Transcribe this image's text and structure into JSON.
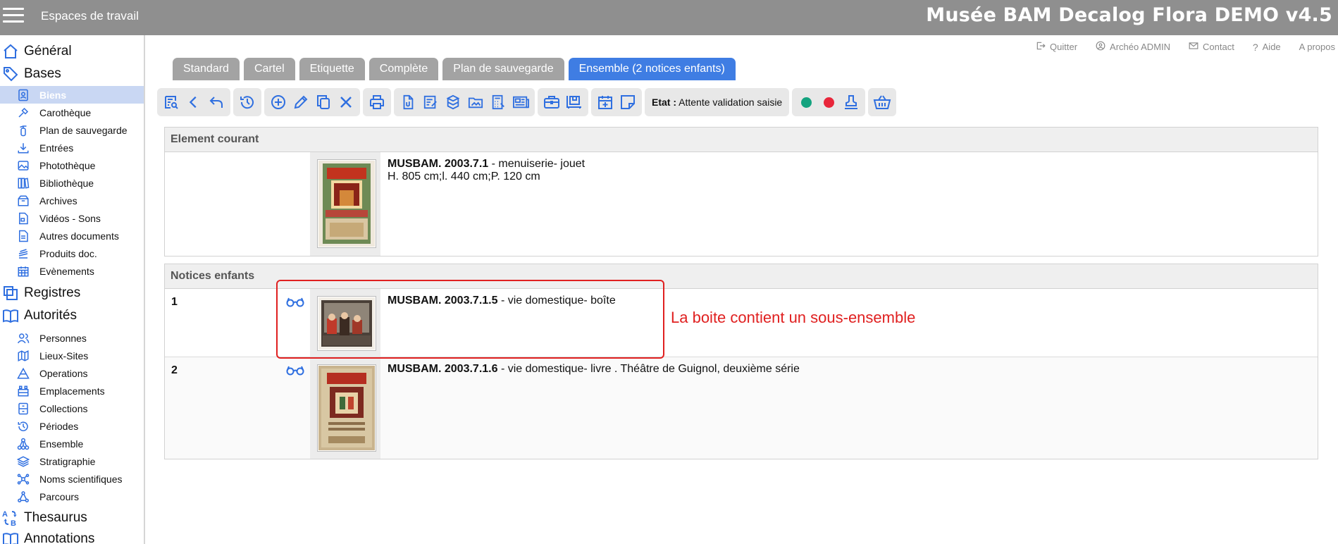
{
  "topbar": {
    "workspaces": "Espaces de travail",
    "app_title": "Musée BAM Decalog Flora DEMO v4.5"
  },
  "sidebar": {
    "sections": [
      {
        "label": "Général",
        "icon": "home-icon"
      },
      {
        "label": "Bases",
        "icon": "tag-icon"
      },
      {
        "label": "Registres",
        "icon": "copy-icon"
      },
      {
        "label": "Autorités",
        "icon": "book-icon"
      },
      {
        "label": "Thesaurus",
        "icon": "sort-az-icon"
      },
      {
        "label": "Annotations",
        "icon": "book-icon"
      }
    ],
    "bases_items": [
      {
        "label": "Biens",
        "icon": "user-badge-icon",
        "active": true
      },
      {
        "label": "Carothèque",
        "icon": "drill-icon"
      },
      {
        "label": "Plan de sauvegarde",
        "icon": "fire-extinguisher-icon"
      },
      {
        "label": "Entrées",
        "icon": "download-icon"
      },
      {
        "label": "Photothèque",
        "icon": "images-icon"
      },
      {
        "label": "Bibliothèque",
        "icon": "books-icon"
      },
      {
        "label": "Archives",
        "icon": "archive-box-icon"
      },
      {
        "label": "Vidéos - Sons",
        "icon": "video-file-icon"
      },
      {
        "label": "Autres documents",
        "icon": "document-icon"
      },
      {
        "label": "Produits doc.",
        "icon": "stack-icon"
      },
      {
        "label": "Evènements",
        "icon": "calendar-icon"
      }
    ],
    "autorites_items": [
      {
        "label": "Personnes",
        "icon": "people-icon"
      },
      {
        "label": "Lieux-Sites",
        "icon": "map-icon"
      },
      {
        "label": "Operations",
        "icon": "pyramid-icon"
      },
      {
        "label": "Emplacements",
        "icon": "storage-icon"
      },
      {
        "label": "Collections",
        "icon": "drawers-icon"
      },
      {
        "label": "Périodes",
        "icon": "history-icon"
      },
      {
        "label": "Ensemble",
        "icon": "hierarchy-icon"
      },
      {
        "label": "Stratigraphie",
        "icon": "layers-icon"
      },
      {
        "label": "Noms scientifiques",
        "icon": "molecule-icon"
      },
      {
        "label": "Parcours",
        "icon": "route-icon"
      }
    ]
  },
  "header_links": [
    {
      "label": "Quitter",
      "icon": "logout-icon"
    },
    {
      "label": "Archéo ADMIN",
      "icon": "user-circle-icon"
    },
    {
      "label": "Contact",
      "icon": "envelope-icon"
    },
    {
      "label": "Aide",
      "icon": "question-icon"
    },
    {
      "label": "A propos",
      "icon": ""
    }
  ],
  "tabs": [
    {
      "label": "Standard",
      "active": false
    },
    {
      "label": "Cartel",
      "active": false
    },
    {
      "label": "Etiquette",
      "active": false
    },
    {
      "label": "Complète",
      "active": false
    },
    {
      "label": "Plan de sauvegarde",
      "active": false
    },
    {
      "label": "Ensemble (2 notices enfants)",
      "active": true
    }
  ],
  "toolbar": {
    "etat_label": "Etat :",
    "etat_value": "Attente validation saisie",
    "status_colors": [
      "#14a37f",
      "#e8263a"
    ]
  },
  "current": {
    "header": "Element courant",
    "code": "MUSBAM. 2003.7.1",
    "title": " - menuiserie- jouet",
    "dimensions": "H. 805 cm;l. 440 cm;P. 120 cm"
  },
  "children": {
    "header": "Notices enfants",
    "rows": [
      {
        "num": "1",
        "code": "MUSBAM. 2003.7.1.5",
        "title": " - vie domestique- boîte"
      },
      {
        "num": "2",
        "code": "MUSBAM. 2003.7.1.6",
        "title": " - vie domestique- livre . Théâtre de Guignol, deuxième série"
      }
    ]
  },
  "annotation": "La boite contient un sous-ensemble",
  "colors": {
    "topbar": "#8f8f8f",
    "accent": "#3f7de3",
    "icon_blue": "#2f6fe0",
    "annotation_red": "#e02020"
  }
}
